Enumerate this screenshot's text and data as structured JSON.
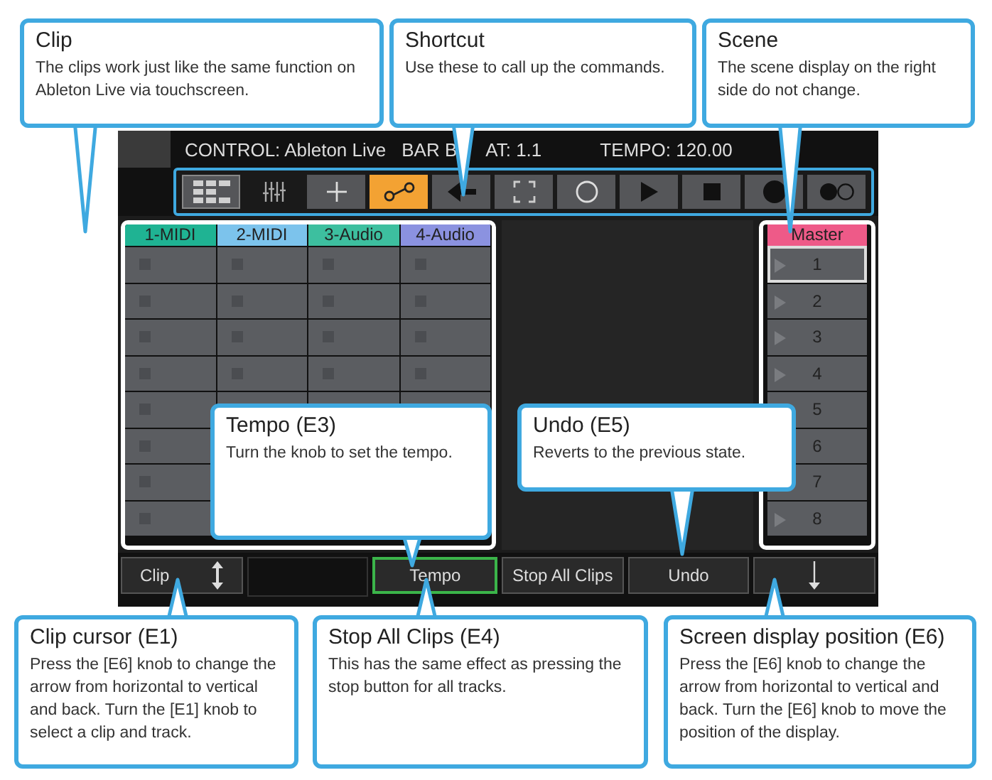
{
  "status_bar": {
    "control": "CONTROL: Ableton Live",
    "position_start": "BAR B",
    "position_end": "AT: 1.1",
    "tempo": "TEMPO: 120.00"
  },
  "toolbar": [
    {
      "kind": "grid",
      "selected": false
    },
    {
      "kind": "mixer",
      "selected": false
    },
    {
      "kind": "plus",
      "selected": false
    },
    {
      "kind": "link",
      "selected": true
    },
    {
      "kind": "back",
      "selected": false
    },
    {
      "kind": "frame",
      "selected": false
    },
    {
      "kind": "ring",
      "selected": false
    },
    {
      "kind": "play",
      "selected": false
    },
    {
      "kind": "stop",
      "selected": false
    },
    {
      "kind": "dot",
      "selected": false
    },
    {
      "kind": "dots",
      "selected": false
    }
  ],
  "tracks": [
    {
      "name": "1-MIDI",
      "color": "#1fb393"
    },
    {
      "name": "2-MIDI",
      "color": "#7cc3ec"
    },
    {
      "name": "3-Audio",
      "color": "#3dbf9f"
    },
    {
      "name": "4-Audio",
      "color": "#8b92e0"
    }
  ],
  "master": {
    "name": "Master",
    "color": "#ee5a88"
  },
  "scenes": [
    {
      "label": "1",
      "has_clip": true,
      "selected": true
    },
    {
      "label": "2",
      "has_clip": true,
      "selected": false
    },
    {
      "label": "3",
      "has_clip": true,
      "selected": false
    },
    {
      "label": "4",
      "has_clip": true,
      "selected": false
    },
    {
      "label": "5",
      "selected": false
    },
    {
      "label": "6",
      "selected": false
    },
    {
      "label": "7",
      "selected": false
    },
    {
      "label": "8",
      "has_clip": true,
      "selected": false
    }
  ],
  "bottom_buttons": [
    {
      "kind": "label_updown",
      "label": "Clip",
      "selected": false
    },
    {
      "kind": "empty"
    },
    {
      "kind": "label",
      "label": "Tempo",
      "selected": true
    },
    {
      "kind": "label",
      "label": "Stop All Clips",
      "selected": false
    },
    {
      "kind": "label",
      "label": "Undo",
      "selected": false
    },
    {
      "kind": "down",
      "selected": false
    }
  ],
  "callouts": [
    {
      "title": "Clip",
      "text": "The clips work just like the same function on Ableton Live via touchscreen."
    },
    {
      "title": "Shortcut",
      "text": "Use these to call up the commands."
    },
    {
      "title": "Scene",
      "text": "The scene display on the right side do not change."
    },
    {
      "title": "Tempo (E3)",
      "text": "Turn the knob to set the tempo."
    },
    {
      "title": "Undo (E5)",
      "text": "Reverts to the previous state."
    },
    {
      "title": "Clip cursor (E1)",
      "text": "Press the [E6] knob to change the arrow from horizontal to vertical and back. Turn the [E1] knob to select a clip and track."
    },
    {
      "title": "Stop All Clips (E4)",
      "text": "This has the same effect as pressing the stop button for all tracks."
    },
    {
      "title": "Screen display position (E6)",
      "text": "Press the [E6] knob to change the arrow from horizontal to vertical and back. Turn the [E6] knob to move the position of the display."
    }
  ]
}
